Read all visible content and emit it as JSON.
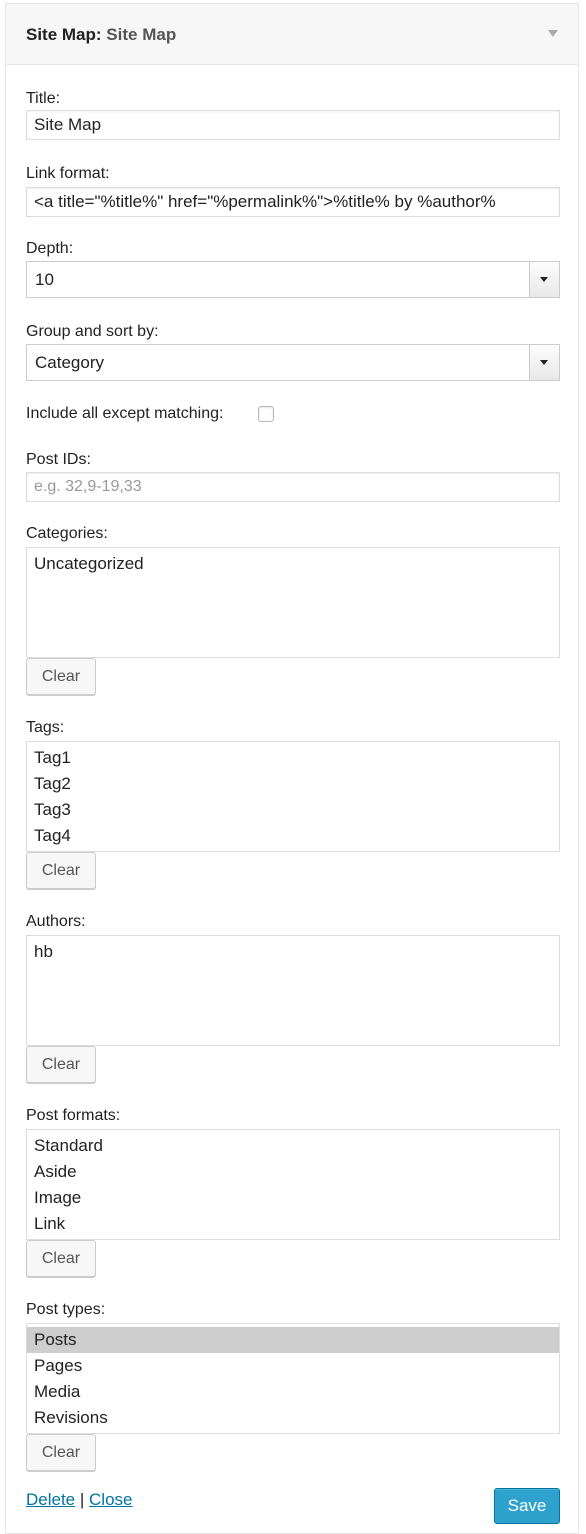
{
  "widget": {
    "title_prefix": "Site Map:",
    "title_name": "Site Map"
  },
  "fields": {
    "title": {
      "label": "Title:",
      "value": "Site Map"
    },
    "link_format": {
      "label": "Link format:",
      "value": "<a title=\"%title%\" href=\"%permalink%\">%title% by %author%"
    },
    "depth": {
      "label": "Depth:",
      "value": "10"
    },
    "group_sort": {
      "label": "Group and sort by:",
      "value": "Category"
    },
    "include_all": {
      "label": "Include all except matching:",
      "checked": false
    },
    "post_ids": {
      "label": "Post IDs:",
      "placeholder": "e.g. 32,9-19,33",
      "value": ""
    },
    "categories": {
      "label": "Categories:",
      "options": [
        "Uncategorized"
      ],
      "clear_label": "Clear"
    },
    "tags": {
      "label": "Tags:",
      "options": [
        "Tag1",
        "Tag2",
        "Tag3",
        "Tag4"
      ],
      "clear_label": "Clear"
    },
    "authors": {
      "label": "Authors:",
      "options": [
        "hb"
      ],
      "clear_label": "Clear"
    },
    "post_formats": {
      "label": "Post formats:",
      "options": [
        "Standard",
        "Aside",
        "Image",
        "Link"
      ],
      "clear_label": "Clear"
    },
    "post_types": {
      "label": "Post types:",
      "options": [
        "Posts",
        "Pages",
        "Media",
        "Revisions"
      ],
      "selected": "Posts",
      "clear_label": "Clear"
    }
  },
  "footer": {
    "delete_label": "Delete",
    "separator": "|",
    "close_label": "Close",
    "save_label": "Save"
  },
  "colors": {
    "link": "#0074a2",
    "primary_button": "#2ea2cc",
    "selected_option": "#cecece"
  }
}
